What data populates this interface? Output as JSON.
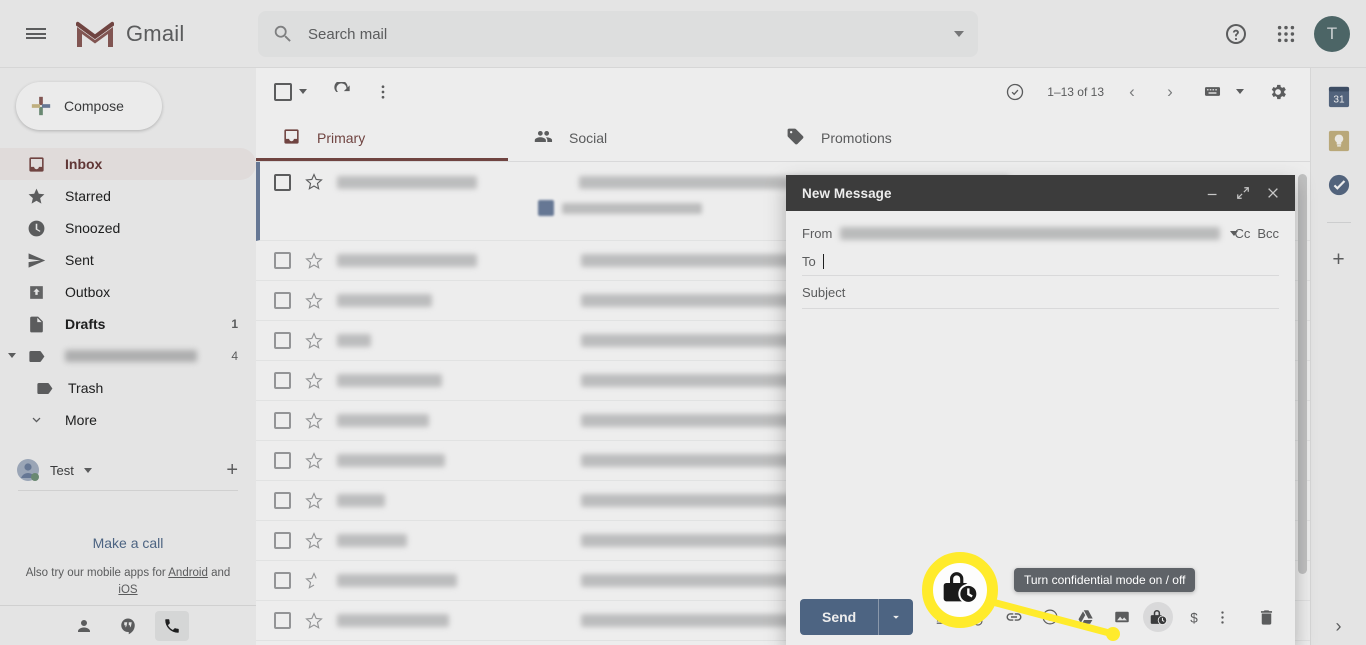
{
  "app": {
    "name": "Gmail",
    "logo_icon": "gmail-m-logo",
    "menu_icon": "hamburger-menu-icon"
  },
  "search": {
    "placeholder": "Search mail",
    "value": "",
    "icon": "search-icon",
    "options_icon": "chevron-down-icon"
  },
  "header_right": {
    "help_icon": "help-circle-icon",
    "apps_icon": "apps-grid-icon",
    "avatar_initial": "T",
    "avatar_color": "#1b7b80"
  },
  "sidebar": {
    "compose_label": "Compose",
    "compose_icon": "plus-icon",
    "items": [
      {
        "label": "Inbox",
        "icon": "inbox-icon",
        "count": "",
        "active": true,
        "bold": true
      },
      {
        "label": "Starred",
        "icon": "star-icon",
        "count": "",
        "active": false,
        "bold": false
      },
      {
        "label": "Snoozed",
        "icon": "clock-icon",
        "count": "",
        "active": false,
        "bold": false
      },
      {
        "label": "Sent",
        "icon": "send-icon",
        "count": "",
        "active": false,
        "bold": false
      },
      {
        "label": "Outbox",
        "icon": "outbox-icon",
        "count": "",
        "active": false,
        "bold": false
      },
      {
        "label": "Drafts",
        "icon": "drafts-icon",
        "count": "1",
        "active": false,
        "bold": true
      },
      {
        "label": "",
        "icon": "label-icon",
        "count": "4",
        "active": false,
        "bold": false,
        "redacted": true
      },
      {
        "label": "Trash",
        "icon": "label-icon",
        "count": "",
        "active": false,
        "bold": false,
        "child": true
      },
      {
        "label": "More",
        "icon": "chevron-down-icon",
        "count": "",
        "active": false,
        "bold": false
      }
    ],
    "account": {
      "name": "Test",
      "caret_icon": "chevron-down-icon",
      "add_icon": "plus-icon",
      "status": "online"
    },
    "hangouts": {
      "make_a_call": "Make a call",
      "promo_prefix": "Also try our mobile apps for ",
      "promo_android": "Android",
      "promo_and": " and ",
      "promo_ios": "iOS"
    },
    "bottom_icons": [
      {
        "name": "contacts-icon",
        "selected": false
      },
      {
        "name": "hangouts-icon",
        "selected": false
      },
      {
        "name": "phone-icon",
        "selected": true
      }
    ]
  },
  "list_toolbar": {
    "select_all_icon": "checkbox-icon",
    "select_caret_icon": "chevron-down-icon",
    "refresh_icon": "refresh-icon",
    "more_icon": "more-vertical-icon",
    "split_pane_icon": "split-pane-icon",
    "pager_text": "1–13 of 13",
    "prev_icon": "chevron-left-icon",
    "next_icon": "chevron-right-icon",
    "input_tools_icon": "keyboard-icon",
    "input_tools_caret": "chevron-down-icon",
    "settings_icon": "gear-icon"
  },
  "tabs": [
    {
      "label": "Primary",
      "icon": "inbox-tab-icon",
      "active": true
    },
    {
      "label": "Social",
      "icon": "people-tab-icon",
      "active": false
    },
    {
      "label": "Promotions",
      "icon": "tag-tab-icon",
      "active": false
    }
  ],
  "rows": [
    {
      "redacted": true,
      "subject_width": 430,
      "first": true,
      "has_attachment": true
    },
    {
      "redacted": true,
      "subject_width": 445
    },
    {
      "redacted": true,
      "subject_width": 440
    },
    {
      "redacted": true,
      "subject_width": 435
    },
    {
      "redacted": true,
      "subject_width": 440
    },
    {
      "redacted": true,
      "subject_width": 430
    },
    {
      "redacted": true,
      "subject_width": 440
    },
    {
      "redacted": true,
      "subject_width": 438
    },
    {
      "redacted": true,
      "subject_width": 444
    },
    {
      "redacted": true,
      "subject_width": 442
    },
    {
      "redacted": true,
      "subject_width": 430
    }
  ],
  "right_rail": {
    "items": [
      {
        "name": "google-calendar-icon",
        "color": "#2f6fd0",
        "label": "31"
      },
      {
        "name": "google-keep-icon",
        "color": "#f4b400",
        "label": ""
      },
      {
        "name": "google-tasks-icon",
        "color": "#2f6fd0",
        "label": ""
      }
    ],
    "add_on_icon": "plus-icon",
    "expand_icon": "chevron-right-icon"
  },
  "compose": {
    "title": "New Message",
    "minimize_icon": "minimize-icon",
    "expand_icon": "expand-diagonal-icon",
    "close_icon": "close-icon",
    "from_label": "From",
    "from_value_redacted": true,
    "from_caret_icon": "chevron-down-icon",
    "cc_label": "Cc",
    "bcc_label": "Bcc",
    "to_label": "To",
    "to_value": "",
    "subject_placeholder": "Subject",
    "body_value": "",
    "send_label": "Send",
    "send_caret_icon": "chevron-down-icon",
    "send_color": "#1a73e8",
    "footer_icons": [
      {
        "name": "format-text-icon",
        "active": false
      },
      {
        "name": "attach-file-icon",
        "active": false
      },
      {
        "name": "insert-link-icon",
        "active": false
      },
      {
        "name": "insert-emoji-icon",
        "active": false
      },
      {
        "name": "google-drive-icon",
        "active": false
      },
      {
        "name": "insert-photo-icon",
        "active": false
      },
      {
        "name": "confidential-mode-icon",
        "active": true
      },
      {
        "name": "insert-money-icon",
        "active": false
      }
    ],
    "more_options_icon": "more-vertical-icon",
    "discard_icon": "trash-icon"
  },
  "annotation": {
    "tooltip_text": "Turn confidential mode on / off",
    "highlight_color": "#ffeb2b",
    "magnified_icon": "confidential-mode-icon"
  }
}
